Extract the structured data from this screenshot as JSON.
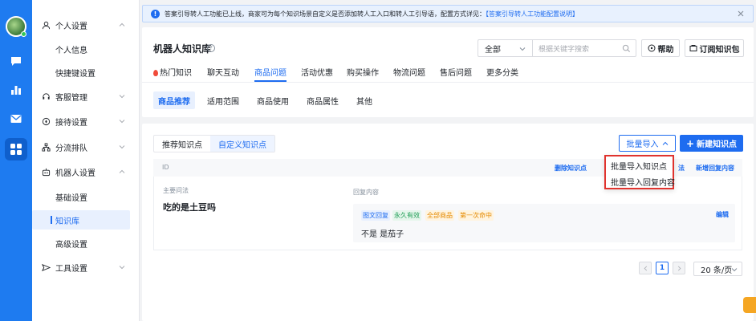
{
  "colors": {
    "accent": "#1e6cf0",
    "rail": "#1e7bf0",
    "dropdown_highlight": "#e0332e",
    "tag_green": "#1f9d55",
    "tag_orange": "#e58a00"
  },
  "rail": {
    "icons": [
      "chat-bubble-icon",
      "bar-chart-icon",
      "mail-icon",
      "grid-apps-icon"
    ]
  },
  "sidebar": {
    "groups": [
      {
        "label": "个人设置",
        "icon": "user-icon",
        "items": [
          "个人信息",
          "快捷键设置"
        ]
      },
      {
        "label": "客服管理",
        "icon": "headset-icon"
      },
      {
        "label": "接待设置",
        "icon": "compass-icon"
      },
      {
        "label": "分流排队",
        "icon": "org-icon"
      },
      {
        "label": "机器人设置",
        "icon": "robot-icon",
        "items": [
          "基础设置",
          "知识库",
          "高级设置"
        ]
      },
      {
        "label": "工具设置",
        "icon": "send-icon"
      }
    ]
  },
  "notice": {
    "text": "答案引导转人工功能已上线，商家可为每个知识场景自定义是否添加转人工入口和转人工引导语，配置方式详见：",
    "link": "【答案引导转人工功能配置说明】"
  },
  "header": {
    "title": "机器人知识库",
    "filter_value": "全部",
    "search_placeholder": "根据关键字搜索",
    "help_label": "帮助",
    "subscribe_label": "订阅知识包"
  },
  "tabs": [
    "热门知识",
    "聊天互动",
    "商品问题",
    "活动优惠",
    "购买操作",
    "物流问题",
    "售后问题",
    "更多分类"
  ],
  "subtabs": [
    "商品推荐",
    "适用范围",
    "商品使用",
    "商品属性",
    "其他"
  ],
  "content": {
    "segments": [
      "推荐知识点",
      "自定义知识点"
    ],
    "import_label": "批量导入",
    "new_label": "新建知识点",
    "list_head": {
      "id": "ID",
      "delete_label": "删除知识点",
      "partial_label": "法",
      "add_reply_label": "新增回复内容"
    },
    "row": {
      "q_label": "主要问法",
      "question": "吃的是土豆吗",
      "r_label": "回复内容",
      "tags": [
        "图文回复",
        "永久有效",
        "全部商品",
        "第一次命中"
      ],
      "edit_label": "编辑",
      "reply": "不是 是茄子"
    },
    "pager": {
      "current": "1",
      "page_size": "20 条/页"
    }
  },
  "dropdown": {
    "items": [
      "批量导入知识点",
      "批量导入回复内容"
    ]
  }
}
